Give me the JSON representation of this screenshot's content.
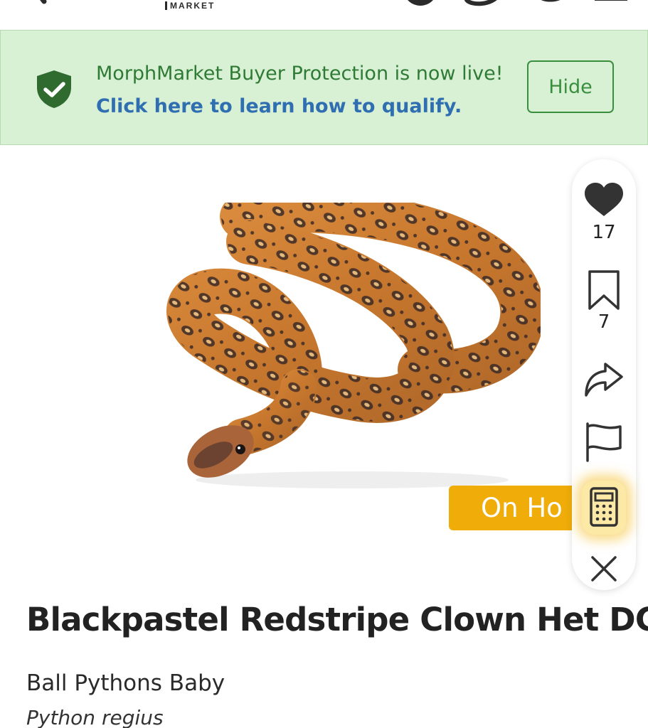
{
  "header": {
    "logo_sub": "MARKET",
    "icons": [
      "user-icon",
      "chat-icon",
      "account-icon",
      "menu-icon"
    ]
  },
  "banner": {
    "text": "MorphMarket Buyer Protection is now live!",
    "link_text": "Click here to learn how to qualify.",
    "hide_label": "Hide",
    "icon": "shield-check-icon",
    "colors": {
      "background": "#d8f0d4",
      "text": "#2f7a34",
      "link": "#2f6fb1"
    }
  },
  "listing": {
    "status_badge": "On Ho",
    "title": "Blackpastel Redstripe Clown Het DG",
    "category": "Ball Pythons Baby",
    "species": "Python regius",
    "badge_color": "#f0ad0a"
  },
  "actions": {
    "likes": "17",
    "saves": "7",
    "icons": [
      "heart-icon",
      "bookmark-icon",
      "share-icon",
      "flag-icon",
      "calculator-icon",
      "close-icon"
    ]
  }
}
